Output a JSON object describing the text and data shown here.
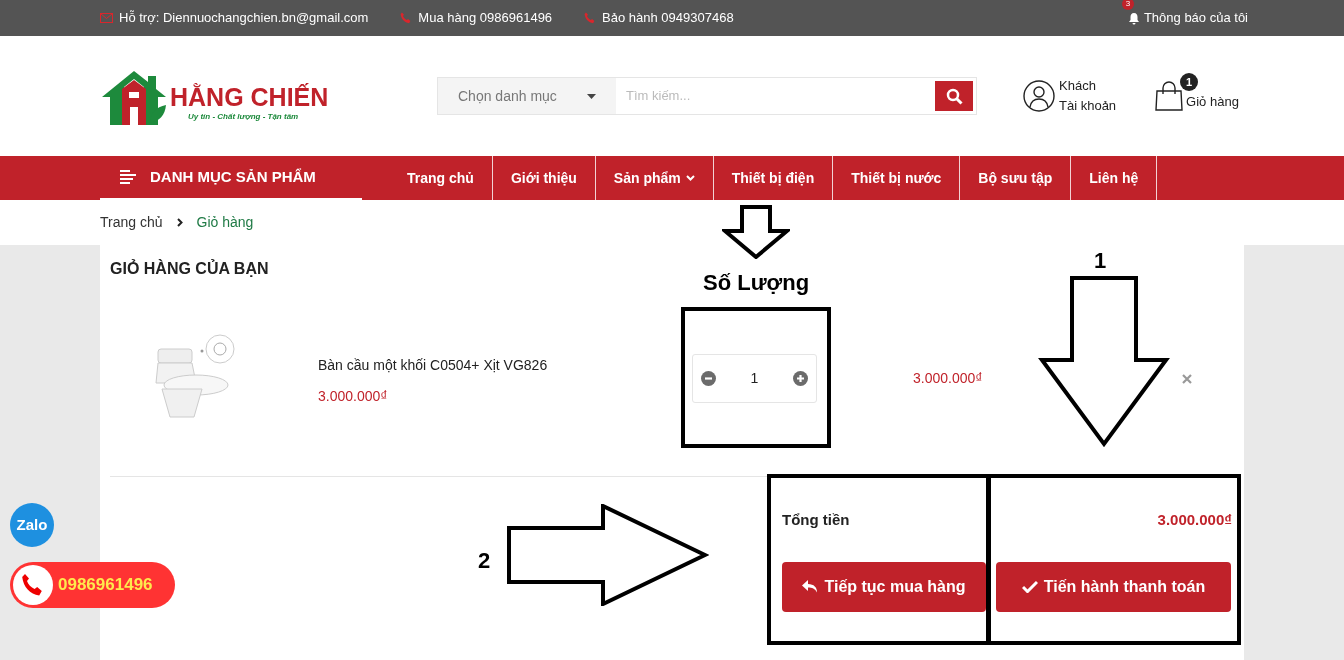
{
  "top_bar": {
    "support": "Hỗ trợ: Diennuochangchien.bn@gmail.com",
    "sales": "Mua hàng 0986961496",
    "warranty": "Bảo hành 0949307468",
    "notifications": {
      "label": "Thông báo của tôi",
      "count": "3"
    }
  },
  "header": {
    "logo": {
      "name": "HẰNG CHIẾN",
      "slogan": "Uy tín - Chất lượng - Tận tâm"
    },
    "search": {
      "category": "Chọn danh mục",
      "placeholder": "Tìm kiếm..."
    },
    "account": {
      "line1": "Khách",
      "line2": "Tài khoản"
    },
    "cart": {
      "label": "Giỏ hàng",
      "count": "1"
    }
  },
  "nav": {
    "category_menu": "DANH MỤC SẢN PHẨM",
    "items": [
      {
        "label": "Trang chủ",
        "has_dropdown": false
      },
      {
        "label": "Giới thiệu",
        "has_dropdown": false
      },
      {
        "label": "Sản phẩm",
        "has_dropdown": true
      },
      {
        "label": "Thiết bị điện",
        "has_dropdown": false
      },
      {
        "label": "Thiết bị nước",
        "has_dropdown": false
      },
      {
        "label": "Bộ sưu tập",
        "has_dropdown": false
      },
      {
        "label": "Liên hệ",
        "has_dropdown": false
      }
    ]
  },
  "breadcrumb": [
    {
      "label": "Trang chủ",
      "current": false
    },
    {
      "label": "Giỏ hàng",
      "current": true
    }
  ],
  "cart": {
    "title": "GIỎ HÀNG CỦA BẠN",
    "items": [
      {
        "kind": "picture",
        "name": "Bàn cầu một khối C0504+ Xịt VG826",
        "price": "3.000.000₫",
        "quantity": "1",
        "line_total": "3.000.000₫"
      }
    ],
    "total_label": "Tổng tiền",
    "total": "3.000.000₫",
    "buttons": [
      {
        "kind": "continue",
        "label": "Tiếp tục mua hàng"
      },
      {
        "kind": "checkout",
        "label": "Tiến hành thanh toán"
      }
    ]
  },
  "floating": {
    "zalo": "Zalo",
    "hotline": "0986961496"
  },
  "annotations": [
    {
      "kind": "label",
      "text": "Số Lượng"
    },
    {
      "kind": "label",
      "text": "1"
    },
    {
      "kind": "label",
      "text": "2"
    }
  ]
}
